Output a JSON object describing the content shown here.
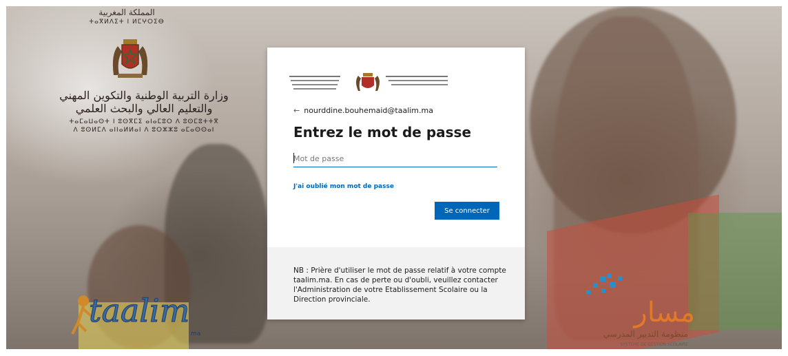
{
  "ministry": {
    "arabic_header": "المملكة المغربية",
    "tifinagh_header": "ⵜⴰⴳⵍⴷⵉⵜ ⵏ ⵍⵎⵖⵔⵉⴱ",
    "name_arabic_line1": "وزارة التربية الوطنية والتكوين المهني",
    "name_arabic_line2": "والتعليم العالي والبحث العلمي",
    "name_tifinagh_line1": "ⵜⴰⵎⴰⵡⴰⵙⵜ ⵏ ⵓⵙⴳⵎⵉ ⴰⵏⴰⵎⵓⵔ ⴷ ⵓⵙⵎⵓⵜⵜⴳ",
    "name_tifinagh_line2": "ⴷ ⵓⵙⵍⵎⴷ ⴰⵏⵏⴰⵍⵍⴰⵏ ⴷ ⵓⵔⵣⵣⵓ ⴰⵎⴰⵙⵙⴰⵏ"
  },
  "logos": {
    "taalim": "taalim",
    "taalim_suffix": "ma",
    "massar_arabic": "مسار",
    "massar_subtitle_arabic": "منظومة التدبير المدرسي",
    "massar_subtitle_fr": "SYSTEME DE GESTION SCOLAIRE"
  },
  "login": {
    "back_arrow_icon": "arrow-left-icon",
    "account": "nourddine.bouhemaid@taalim.ma",
    "title": "Entrez le mot de passe",
    "password_placeholder": "Mot de passe",
    "forgot_link": "J'ai oublié mon mot de passe",
    "signin_button": "Se connecter",
    "note": "NB : Prière d'utiliser le mot de passe relatif à votre compte taalim.ma. En cas de perte ou d'oubli, veuillez contacter l'Administration de votre Etablissement Scolaire ou la Direction provinciale."
  },
  "colors": {
    "accent": "#0067b8",
    "note_background": "#f2f2f2"
  }
}
